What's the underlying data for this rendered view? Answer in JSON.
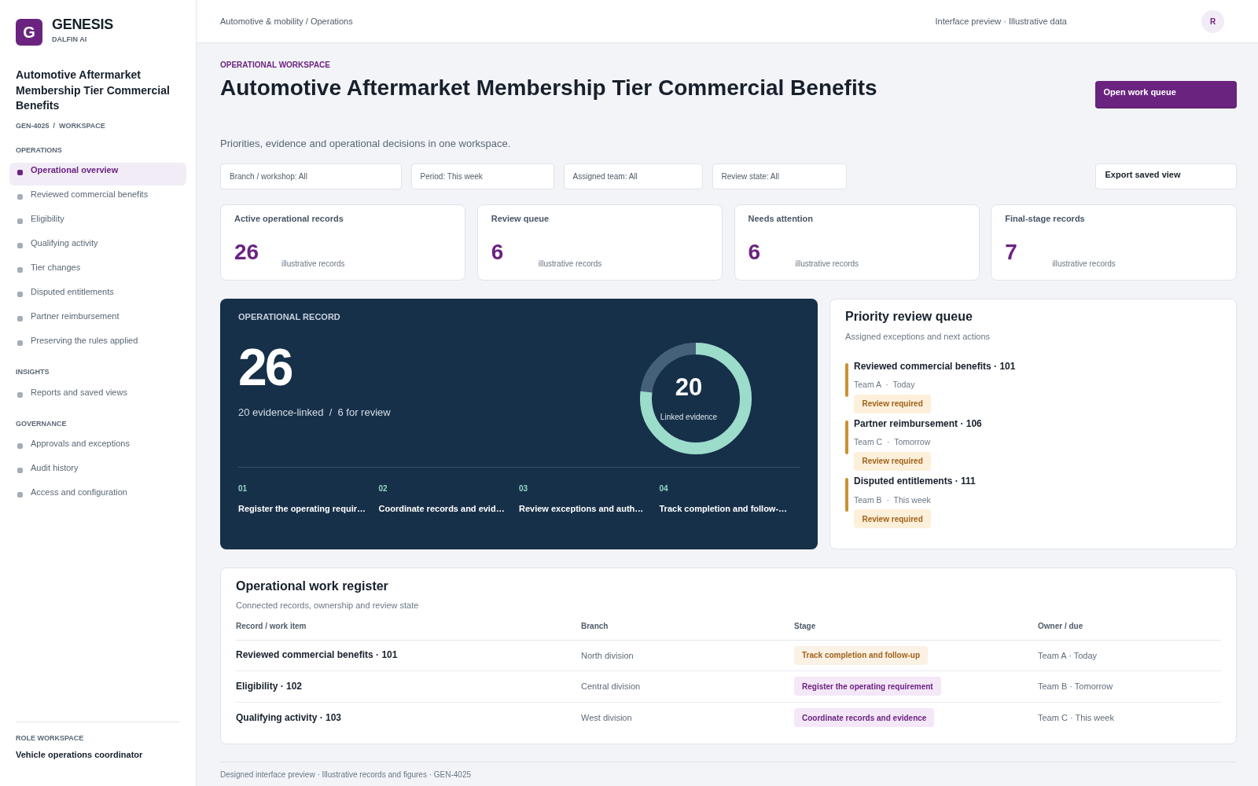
{
  "sidebar": {
    "brand": {
      "mark": "G",
      "name": "GENESIS",
      "org": "DALFIN AI"
    },
    "workspace_title": "Automotive Aftermarket Membership Tier Commercial Benefits",
    "workspace_path": "GEN-4025  /  WORKSPACE",
    "sections": [
      {
        "heading": "OPERATIONS",
        "items": [
          {
            "label": "Operational overview",
            "selected": true
          },
          {
            "label": "Reviewed commercial benefits",
            "selected": false
          },
          {
            "label": "Eligibility",
            "selected": false
          },
          {
            "label": "Qualifying activity",
            "selected": false
          },
          {
            "label": "Tier changes",
            "selected": false
          },
          {
            "label": "Disputed entitlements",
            "selected": false
          },
          {
            "label": "Partner reimbursement",
            "selected": false
          },
          {
            "label": "Preserving the rules applied",
            "selected": false
          }
        ]
      },
      {
        "heading": "INSIGHTS",
        "items": [
          {
            "label": "Reports and saved views",
            "selected": false
          }
        ]
      },
      {
        "heading": "GOVERNANCE",
        "items": [
          {
            "label": "Approvals and exceptions",
            "selected": false
          },
          {
            "label": "Audit history",
            "selected": false
          },
          {
            "label": "Access and configuration",
            "selected": false
          }
        ]
      }
    ],
    "role": {
      "heading": "ROLE WORKSPACE",
      "name": "Vehicle operations coordinator"
    }
  },
  "top_bar": {
    "breadcrumb": "Automotive & mobility / Operations",
    "note": "Interface preview · Illustrative data",
    "avatar": "R"
  },
  "page": {
    "eyebrow": "OPERATIONAL WORKSPACE",
    "title": "Automotive Aftermarket Membership Tier Commercial Benefits",
    "primary_action": "Open work queue",
    "subtitle": "Priorities, evidence and operational decisions in one workspace."
  },
  "filters": [
    "Branch / workshop: All",
    "Period: This week",
    "Assigned team: All",
    "Review state: All"
  ],
  "export_action": "Export saved view",
  "kpis": [
    {
      "label": "Active operational records",
      "value": "26",
      "note": "illustrative records"
    },
    {
      "label": "Review queue",
      "value": "6",
      "note": "illustrative records"
    },
    {
      "label": "Needs attention",
      "value": "6",
      "note": "illustrative records"
    },
    {
      "label": "Final-stage records",
      "value": "7",
      "note": "illustrative records"
    }
  ],
  "record_panel": {
    "eyebrow": "OPERATIONAL RECORD",
    "value": "26",
    "summary": "20 evidence-linked  /  6 for review",
    "gauge": {
      "value": "20",
      "label": "Linked evidence",
      "level": 0.77
    },
    "steps": [
      {
        "number": "01",
        "label": "Register the operating requir…"
      },
      {
        "number": "02",
        "label": "Coordinate records and evid…"
      },
      {
        "number": "03",
        "label": "Review exceptions and auth…"
      },
      {
        "number": "04",
        "label": "Track completion and follow-…"
      }
    ]
  },
  "review_queue": {
    "title": "Priority review queue",
    "subtitle": "Assigned exceptions and next actions",
    "items": [
      {
        "title": "Reviewed commercial benefits · 101",
        "meta": "Team A  ·  Today",
        "status": "Review required"
      },
      {
        "title": "Partner reimbursement · 106",
        "meta": "Team C  ·  Tomorrow",
        "status": "Review required"
      },
      {
        "title": "Disputed entitlements · 111",
        "meta": "Team B  ·  This week",
        "status": "Review required"
      }
    ]
  },
  "register": {
    "title": "Operational work register",
    "subtitle": "Connected records, ownership and review state",
    "columns": [
      "Record / work item",
      "Branch",
      "Stage",
      "Owner / due"
    ],
    "rows": [
      {
        "record": "Reviewed commercial benefits · 101",
        "branch": "North division",
        "stage": {
          "label": "Track completion and follow-up",
          "color": "#a0621a"
        },
        "owner": "Team A · Today"
      },
      {
        "record": "Eligibility · 102",
        "branch": "Central division",
        "stage": {
          "label": "Register the operating requirement",
          "color": "#6b2380"
        },
        "owner": "Team B · Tomorrow"
      },
      {
        "record": "Qualifying activity · 103",
        "branch": "West division",
        "stage": {
          "label": "Coordinate records and evidence",
          "color": "#6b2380"
        },
        "owner": "Team C · This week"
      }
    ]
  },
  "footer": "Designed interface preview · Illustrative records and figures · GEN-4025"
}
